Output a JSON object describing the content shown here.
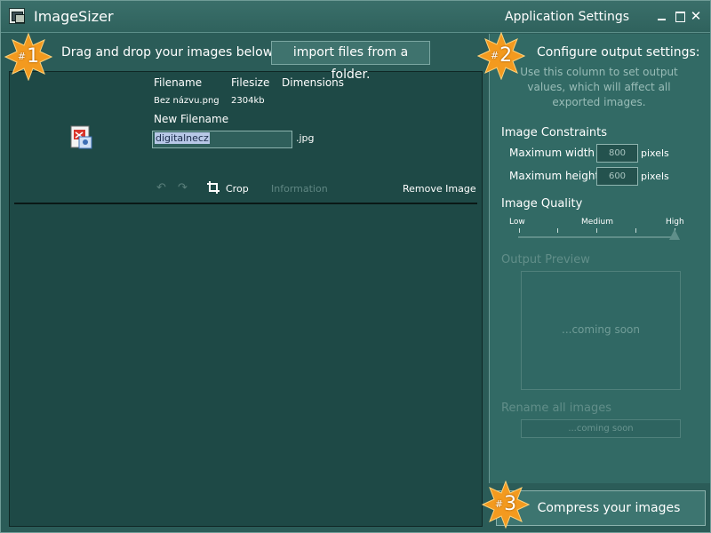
{
  "window": {
    "app_title": "ImageSizer",
    "settings_title": "Application Settings",
    "close_glyph": "✕"
  },
  "badges": [
    {
      "prefix": "#",
      "number": "1"
    },
    {
      "prefix": "#",
      "number": "2"
    },
    {
      "prefix": "#",
      "number": "3"
    }
  ],
  "left": {
    "instruction": "Drag and drop your images below, or",
    "import_button": "import files from a folder.",
    "columns": {
      "filename": "Filename",
      "filesize": "Filesize",
      "dimensions": "Dimensions"
    },
    "file": {
      "filename": "Bez názvu.png",
      "filesize": "2304kb",
      "new_filename_label": "New Filename",
      "new_filename_value": "digitalnecz",
      "extension": ".jpg",
      "icon": "document-image-icon"
    },
    "toolbar": {
      "undo_glyph": "↶",
      "redo_glyph": "↷",
      "crop": "Crop",
      "information": "Information",
      "remove": "Remove Image"
    }
  },
  "right": {
    "configure_title": "Configure output settings:",
    "configure_desc": "Use this column to set output values, which will affect all exported images.",
    "constraints_heading": "Image Constraints",
    "max_width_label": "Maximum width",
    "max_width_value": "800",
    "max_height_label": "Maximum height",
    "max_height_value": "600",
    "unit": "pixels",
    "quality_heading": "Image Quality",
    "quality_low": "Low",
    "quality_medium": "Medium",
    "quality_high": "High",
    "quality_level": 1.0,
    "preview_heading": "Output Preview",
    "preview_placeholder": "...coming soon",
    "rename_heading": "Rename all images",
    "rename_placeholder": "...coming soon",
    "compress_button": "Compress your images"
  },
  "colors": {
    "background": "#2b5c58",
    "list_panel": "#1e4946",
    "settings_panel": "#326a65",
    "badge_star": "#f39a1f"
  }
}
